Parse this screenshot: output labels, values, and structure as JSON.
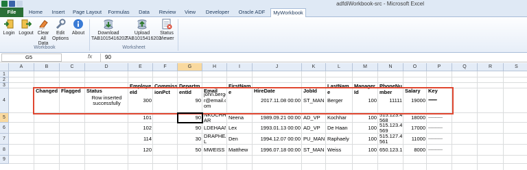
{
  "window": {
    "title": "adfdiWorkbook-src - Microsoft Excel"
  },
  "tabs": [
    "File",
    "Home",
    "Insert",
    "Page Layout",
    "Formulas",
    "Data",
    "Review",
    "View",
    "Developer",
    "Oracle ADF",
    "MyWorkbook"
  ],
  "ribbon": {
    "workbook_group": {
      "label": "Workbook",
      "buttons": [
        "Login",
        "Logout",
        "Clear All Data",
        "Edit Options",
        "About"
      ]
    },
    "worksheet_group": {
      "label": "Worksheet",
      "buttons": [
        "Download TAB1015416202",
        "Upload TAB1015416202",
        "Status Viewer"
      ]
    }
  },
  "formula_bar": {
    "cell_ref": "G5",
    "fx": "fx",
    "value": "90"
  },
  "columns": [
    "A",
    "B",
    "C",
    "D",
    "E",
    "F",
    "G",
    "H",
    "I",
    "J",
    "K",
    "L",
    "M",
    "N",
    "O",
    "P",
    "Q",
    "R",
    "S"
  ],
  "selected_column": "G",
  "rows": [
    "1",
    "2",
    "3",
    "4",
    "5",
    "6",
    "7",
    "8",
    "9"
  ],
  "selected_row": "5",
  "table": {
    "headers": [
      "Changed",
      "Flagged",
      "Status",
      "EmployeeId",
      "CommissionPct",
      "DepartmentId",
      "Email",
      "FirstName",
      "HireDate",
      "JobId",
      "LastName",
      "ManagerId",
      "PhoneNumber",
      "Salary",
      "Key"
    ],
    "header_display": {
      "employee": [
        "Employe",
        "eId"
      ],
      "commission": [
        "Commiss",
        "ionPct"
      ],
      "department": [
        "Departm",
        "entId"
      ],
      "firstname": [
        "FirstNam",
        "e"
      ],
      "lastname": [
        "LastNam",
        "e"
      ],
      "manager": [
        "Manager",
        "Id"
      ],
      "phone": [
        "PhoneNu",
        "mber"
      ]
    },
    "rows": [
      {
        "status": [
          "Row inserted",
          "successfully"
        ],
        "employee_id": "300",
        "department_id": "90",
        "email": [
          "john.berge",
          "r@email.c",
          "om"
        ],
        "first_name": "",
        "hire_date": "2017.11.08 00:00",
        "job_id": "ST_MAN",
        "last_name": "Berger",
        "manager_id": "100",
        "phone": "11111",
        "salary": "19000",
        "key": "•••••••••••"
      },
      {
        "employee_id": "101",
        "department_id": "90",
        "email": [
          "NKOCHH",
          "AR"
        ],
        "first_name": "Neena",
        "hire_date": "1989.09.21 00:00",
        "job_id": "AD_VP",
        "last_name": "Kochhar",
        "manager_id": "100",
        "phone": [
          "515.123.4",
          "568"
        ],
        "salary": "18000",
        "key": "————"
      },
      {
        "employee_id": "102",
        "department_id": "90",
        "email": [
          "LDEHAAN"
        ],
        "first_name": "Lex",
        "hire_date": "1993.01.13 00:00",
        "job_id": "AD_VP",
        "last_name": "De Haan",
        "manager_id": "100",
        "phone": [
          "515.123.4",
          "569"
        ],
        "salary": "17000",
        "key": "————"
      },
      {
        "employee_id": "114",
        "department_id": "30",
        "email": [
          "DRAPHEA",
          "L"
        ],
        "first_name": "Den",
        "hire_date": "1994.12.07 00:00",
        "job_id": "PU_MAN",
        "last_name": "Raphaely",
        "manager_id": "100",
        "phone": [
          "515.127.4",
          "561"
        ],
        "salary": "11000",
        "key": "————"
      },
      {
        "employee_id": "120",
        "department_id": "50",
        "email": [
          "MWEISS"
        ],
        "first_name": "Matthew",
        "hire_date": "1996.07.18 00:00",
        "job_id": "ST_MAN",
        "last_name": "Weiss",
        "manager_id": "100",
        "phone": [
          "650.123.1"
        ],
        "salary": "8000",
        "key": "————"
      }
    ]
  },
  "colors": {
    "file_tab": "#2a6f36",
    "highlight_border": "#e0462f",
    "selected_header": "#f9d99f"
  }
}
